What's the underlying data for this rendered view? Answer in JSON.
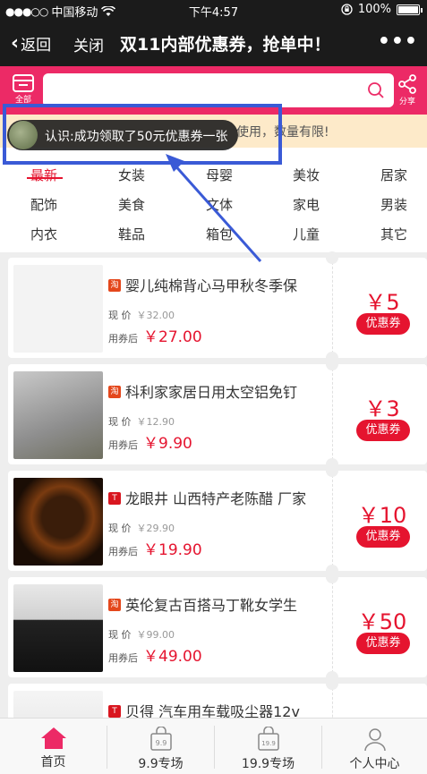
{
  "status_bar": {
    "carrier": "中国移动",
    "time": "下午4:57",
    "battery": "100%",
    "battery_level": 1.0
  },
  "nav": {
    "back_label": "返回",
    "close_label": "关闭",
    "title": "双11内部优惠券，抢单中！",
    "more_icon": "more-dots-icon"
  },
  "search": {
    "placeholder": "",
    "left_icon_label": "全部",
    "share_label": "分享"
  },
  "notice": {
    "text": "使用，数量有限!"
  },
  "toast": {
    "text": "认识:成功领取了50元优惠券一张"
  },
  "categories": [
    "最新",
    "女装",
    "母婴",
    "美妆",
    "居家",
    "配饰",
    "美食",
    "文体",
    "家电",
    "男装",
    "内衣",
    "鞋品",
    "箱包",
    "儿童",
    "其它"
  ],
  "active_category": "最新",
  "products": [
    {
      "source": "淘",
      "title": "婴儿纯棉背心马甲秋冬季保",
      "now_label": "现 价",
      "now_price": "￥32.00",
      "after_label": "用券后",
      "after_price": "￥27.00",
      "coupon": "￥5",
      "coupon_btn": "优惠券"
    },
    {
      "source": "淘",
      "title": "科利家家居日用太空铝免钉",
      "now_label": "现 价",
      "now_price": "￥12.90",
      "after_label": "用券后",
      "after_price": "￥9.90",
      "coupon": "￥3",
      "coupon_btn": "优惠券"
    },
    {
      "source": "T",
      "title": "龙眼井 山西特产老陈醋 厂家",
      "now_label": "现 价",
      "now_price": "￥29.90",
      "after_label": "用券后",
      "after_price": "￥19.90",
      "coupon": "￥10",
      "coupon_btn": "优惠券"
    },
    {
      "source": "淘",
      "title": "英伦复古百搭马丁靴女学生",
      "now_label": "现 价",
      "now_price": "￥99.00",
      "after_label": "用券后",
      "after_price": "￥49.00",
      "coupon": "￥50",
      "coupon_btn": "优惠券"
    },
    {
      "source": "T",
      "title": "贝得 汽车用车载吸尘器12v"
    }
  ],
  "tabs": [
    {
      "label": "首页",
      "icon": "home-icon"
    },
    {
      "label": "9.9专场",
      "icon": "bag-9-9-icon"
    },
    {
      "label": "19.9专场",
      "icon": "bag-19-9-icon"
    },
    {
      "label": "个人中心",
      "icon": "user-icon"
    }
  ],
  "colors": {
    "brand": "#ec2a66",
    "price": "#e5142f",
    "nav_bg": "#1b1b1b",
    "notice_bg": "#fdeac9"
  }
}
